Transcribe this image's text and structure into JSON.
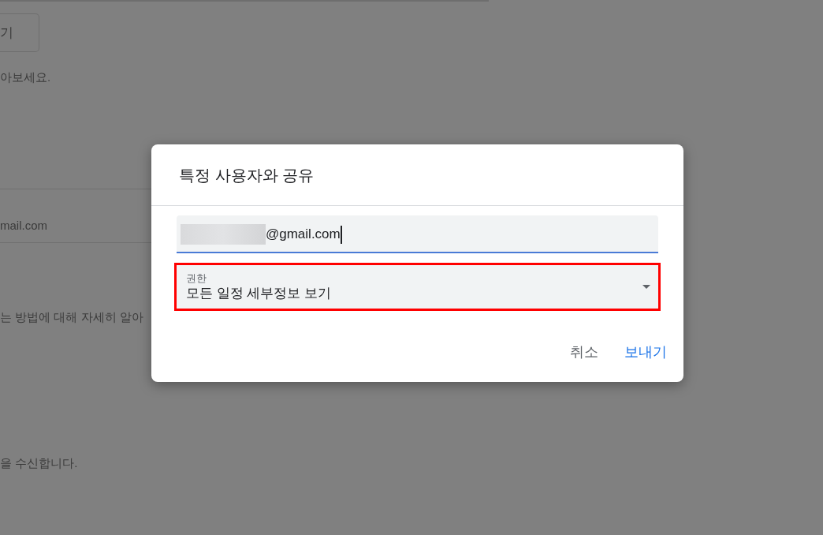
{
  "background_page": {
    "button_label": "기",
    "help_text": "아보세요.",
    "list_row": "mail.com",
    "learn_more_text": "는 방법에 대해 자세히 알아",
    "notice_text": "을 수신합니다."
  },
  "dialog": {
    "title": "특정 사용자와 공유",
    "email_field": {
      "value": "@gmail.com",
      "focused": true
    },
    "permission_select": {
      "label": "권한",
      "value": "모든 일정 세부정보 보기",
      "highlighted": true
    },
    "buttons": [
      {
        "label": "취소",
        "kind": "secondary"
      },
      {
        "label": "보내기",
        "kind": "primary"
      }
    ]
  }
}
